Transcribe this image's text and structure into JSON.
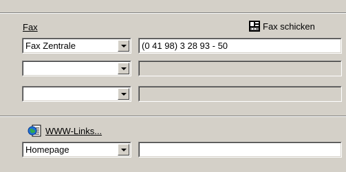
{
  "fax": {
    "section_label": "Fax",
    "send_button_label": "Fax schicken",
    "rows": [
      {
        "type": "Fax Zentrale",
        "number": "(0 41 98) 3 28 93 - 50",
        "number_enabled": true
      },
      {
        "type": "",
        "number": "",
        "number_enabled": false
      },
      {
        "type": "",
        "number": "",
        "number_enabled": false
      }
    ]
  },
  "web": {
    "links_label": "WWW-Links...",
    "row": {
      "type": "Homepage",
      "url": ""
    }
  },
  "icons": {
    "fax": "fax-machine-icon",
    "web": "globe-page-icon",
    "dropdown": "chevron-down-icon"
  }
}
